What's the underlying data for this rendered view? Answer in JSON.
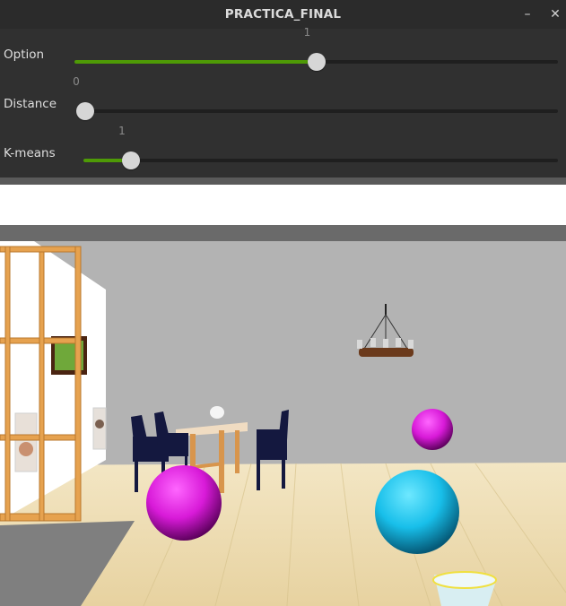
{
  "window": {
    "title": "PRACTICA_FINAL",
    "minimize_icon": "minimize-icon",
    "close_icon": "close-icon"
  },
  "sliders": [
    {
      "label": "Option",
      "value": "1",
      "fraction": 0.5
    },
    {
      "label": "Distance",
      "value": "0",
      "fraction": 0
    },
    {
      "label": "K-means",
      "value": "1",
      "fraction": 0.1
    }
  ],
  "colors": {
    "accent": "#4e9a06",
    "titlebar": "#2b2b2b",
    "panel": "#303030",
    "magenta_sphere": "#e21ee2",
    "cyan_sphere": "#1ec8f0",
    "wall": "#b3b3b3",
    "floor": "#eedcb0"
  }
}
